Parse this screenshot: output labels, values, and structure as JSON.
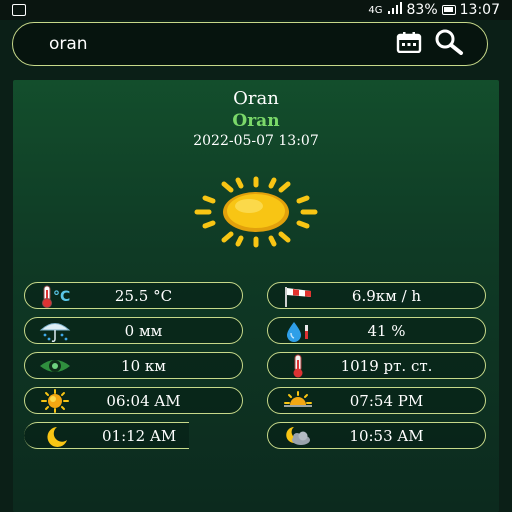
{
  "status_bar": {
    "network": "4G",
    "battery": "83%",
    "time": "13:07"
  },
  "search": {
    "value": "oran",
    "icons": [
      "calendar-icon",
      "search-icon"
    ]
  },
  "weather": {
    "city": "Oran",
    "city_local": "Oran",
    "datetime": "2022-05-07 13:07",
    "condition_icon": "sun-icon",
    "stats": [
      {
        "icon": "thermometer-celsius-icon",
        "value": "25.5 °C"
      },
      {
        "icon": "windsock-icon",
        "value": "6.9км / h"
      },
      {
        "icon": "umbrella-rain-icon",
        "value": "0 мм"
      },
      {
        "icon": "humidity-drop-icon",
        "value": "41 %"
      },
      {
        "icon": "visibility-eye-icon",
        "value": "10 км"
      },
      {
        "icon": "pressure-thermometer-icon",
        "value": "1019 рт. ст."
      },
      {
        "icon": "sunrise-icon",
        "value": "06:04 AM"
      },
      {
        "icon": "sunset-icon",
        "value": "07:54 PM"
      },
      {
        "icon": "moonrise-icon",
        "value": "01:12 AM"
      },
      {
        "icon": "moonset-icon",
        "value": "10:53 AM"
      }
    ]
  },
  "colors": {
    "accent_border": "#c7d98a",
    "city_sub": "#7bd96a",
    "sun": "#f8c514"
  }
}
